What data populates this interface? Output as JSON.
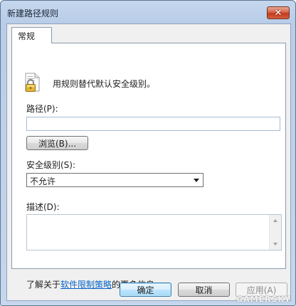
{
  "window": {
    "title": "新建路径规则",
    "close_symbol": "✕"
  },
  "tabs": [
    {
      "label": "常规",
      "selected": true
    }
  ],
  "general": {
    "icon": "lock-certificate-icon",
    "description": "用规则替代默认安全级别。",
    "path_label": "路径(P):",
    "path_value": "",
    "browse_label": "浏览(B)...",
    "security_label": "安全级别(S):",
    "security_value": "不允许",
    "desc_label": "描述(D):",
    "desc_value": "",
    "info_prefix": "了解关于",
    "info_link": "软件限制策略",
    "info_suffix": "的更多信息"
  },
  "buttons": {
    "ok": "确定",
    "cancel": "取消",
    "apply": "应用(A)",
    "apply_enabled": false
  },
  "watermark": "GAMERSKY",
  "colors": {
    "title_bar": "#c5d7ee",
    "close_button": "#c2391d",
    "link": "#0a66c9",
    "default_button_border": "#3c7fb1"
  }
}
